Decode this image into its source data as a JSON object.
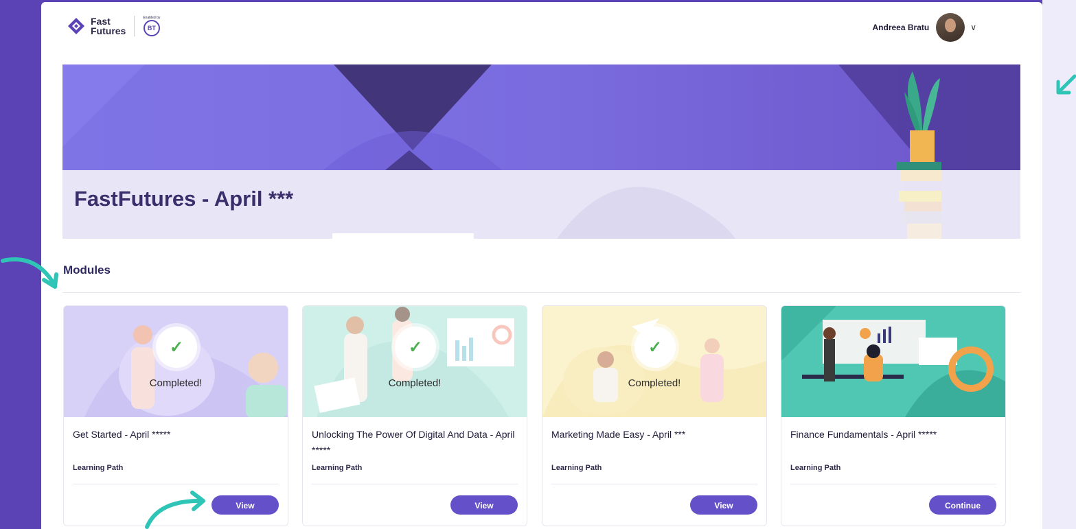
{
  "header": {
    "logo_text_line1": "Fast",
    "logo_text_line2": "Futures",
    "partner_enabled": "Enabled by",
    "partner_logo": "BT",
    "user_name": "Andreea Bratu"
  },
  "banner": {
    "title": "FastFutures - April ***"
  },
  "modules": {
    "heading": "Modules",
    "cards": [
      {
        "title": "Get Started - April *****",
        "type": "Learning Path",
        "status": "Completed!",
        "button": "View"
      },
      {
        "title": "Unlocking The Power Of Digital And Data - April *****",
        "type": "Learning Path",
        "status": "Completed!",
        "button": "View"
      },
      {
        "title": "Marketing Made Easy - April ***",
        "type": "Learning Path",
        "status": "Completed!",
        "button": "View"
      },
      {
        "title": "Finance Fundamentals - April *****",
        "type": "Learning Path",
        "button": "Continue"
      }
    ]
  },
  "colors": {
    "brand_purple": "#5b43b6",
    "button": "#6450c8",
    "check_green": "#4caf50",
    "annotation_teal": "#2ec4b6"
  },
  "icons": [
    "fastfutures-logo-icon",
    "bt-logo-icon",
    "chevron-down-icon",
    "check-icon",
    "annotation-arrow-icon"
  ]
}
